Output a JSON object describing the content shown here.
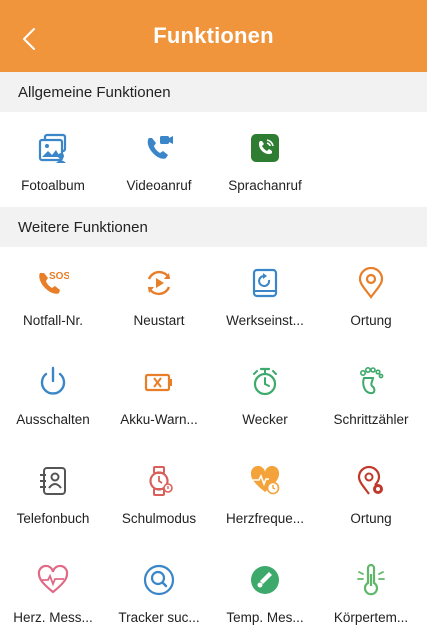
{
  "header": {
    "title": "Funktionen",
    "back_icon": "chevron-left-icon",
    "color": "#F0953B"
  },
  "sections": [
    {
      "title": "Allgemeine Funktionen"
    },
    {
      "title": "Weitere Funktionen"
    }
  ],
  "general": [
    {
      "label": "Fotoalbum",
      "icon": "photo-album-icon"
    },
    {
      "label": "Videoanruf",
      "icon": "video-call-icon"
    },
    {
      "label": "Sprachanruf",
      "icon": "voice-call-icon"
    }
  ],
  "more": [
    {
      "label": "Notfall-Nr.",
      "icon": "sos-call-icon"
    },
    {
      "label": "Neustart",
      "icon": "restart-icon"
    },
    {
      "label": "Werkseinst...",
      "icon": "factory-reset-icon"
    },
    {
      "label": "Ortung",
      "icon": "location-pin-icon"
    },
    {
      "label": "Ausschalten",
      "icon": "power-icon"
    },
    {
      "label": "Akku-Warn...",
      "icon": "battery-warning-icon"
    },
    {
      "label": "Wecker",
      "icon": "alarm-clock-icon"
    },
    {
      "label": "Schrittzähler",
      "icon": "footprint-icon"
    },
    {
      "label": "Telefonbuch",
      "icon": "phonebook-icon"
    },
    {
      "label": "Schulmodus",
      "icon": "watch-icon"
    },
    {
      "label": "Herzfreque...",
      "icon": "heart-rate-icon"
    },
    {
      "label": "Ortung",
      "icon": "location-target-icon"
    },
    {
      "label": "Herz. Mess...",
      "icon": "heart-measure-icon"
    },
    {
      "label": "Tracker suc...",
      "icon": "tracker-search-icon"
    },
    {
      "label": "Temp. Mes...",
      "icon": "thermometer-icon"
    },
    {
      "label": "Körpertem...",
      "icon": "body-temperature-icon"
    }
  ]
}
